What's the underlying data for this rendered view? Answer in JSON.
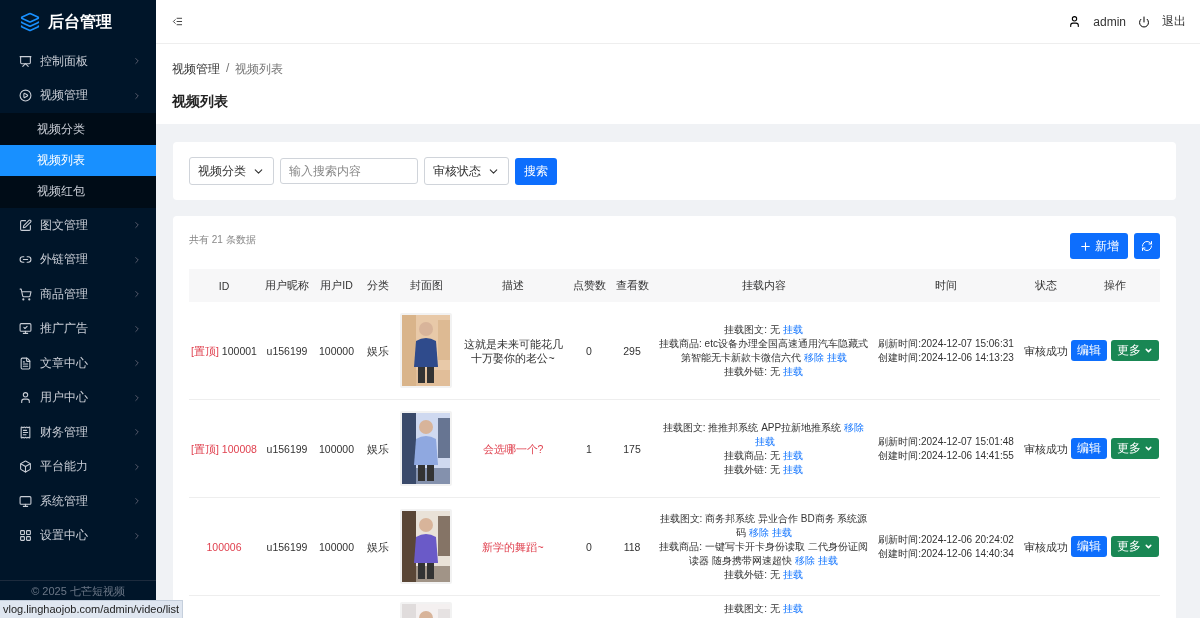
{
  "sidebar": {
    "logo": "后台管理",
    "items": [
      {
        "label": "控制面板",
        "selected": false
      },
      {
        "label": "视频管理",
        "expanded": true,
        "selected": false,
        "children": [
          {
            "label": "视频分类",
            "selected": false
          },
          {
            "label": "视频列表",
            "selected": true
          },
          {
            "label": "视频红包",
            "selected": false
          }
        ]
      },
      {
        "label": "图文管理",
        "selected": false
      },
      {
        "label": "外链管理",
        "selected": false
      },
      {
        "label": "商品管理",
        "selected": false
      },
      {
        "label": "推广广告",
        "selected": false
      },
      {
        "label": "文章中心",
        "selected": false
      },
      {
        "label": "用户中心",
        "selected": false
      },
      {
        "label": "财务管理",
        "selected": false
      },
      {
        "label": "平台能力",
        "selected": false
      },
      {
        "label": "系统管理",
        "selected": false
      },
      {
        "label": "设置中心",
        "selected": false
      }
    ],
    "footer": "© 2025 七芒短视频"
  },
  "header": {
    "user": "admin",
    "logout": "退出"
  },
  "breadcrumb": {
    "items": [
      "视频管理",
      "视频列表"
    ],
    "separator": "/"
  },
  "page_title": "视频列表",
  "filters": {
    "category_select": "视频分类",
    "search": {
      "placeholder": "输入搜索内容"
    },
    "status_select": "审核状态",
    "search_button": "搜索"
  },
  "table": {
    "summary": "共有 21 条数据",
    "add_button": "新增",
    "columns": [
      "ID",
      "用户昵称",
      "用户ID",
      "分类",
      "封面图",
      "描述",
      "点赞数",
      "查看数",
      "挂载内容",
      "时间",
      "状态",
      "操作"
    ],
    "rows": [
      {
        "pinned_tag": "[置顶]",
        "id": "100001",
        "highlight": false,
        "nickname": "u156199",
        "user_id": "100000",
        "category": "娱乐",
        "cover": {
          "kind": "picture"
        },
        "description": "这就是未来可能花几十万娶你的老公~",
        "likes": "0",
        "views": "295",
        "mounts": [
          {
            "text": "挂载图文: 无",
            "links": [
              "挂载"
            ]
          },
          {
            "text": "挂载商品: etc设备办理全国高速通用汽车隐藏式第智能无卡新款卡微信六代",
            "links": [
              "移除",
              "挂载"
            ]
          },
          {
            "text": "挂载外链: 无",
            "links": [
              "挂载"
            ]
          }
        ],
        "refresh_time": "刷新时间:2024-12-07 15:06:31",
        "create_time": "创建时间:2024-12-06 14:13:23",
        "status": "审核成功",
        "actions": [
          "编辑",
          "更多"
        ]
      },
      {
        "pinned_tag": "[置顶]",
        "id": "100008",
        "highlight": true,
        "nickname": "u156199",
        "user_id": "100000",
        "category": "娱乐",
        "cover": {
          "kind": "picture"
        },
        "description": "会选哪一个?",
        "likes": "1",
        "views": "175",
        "mounts": [
          {
            "text": "挂载图文: 推推邦系统 APP拉新地推系统",
            "links": [
              "移除",
              "挂载"
            ]
          },
          {
            "text": "挂载商品: 无",
            "links": [
              "挂载"
            ]
          },
          {
            "text": "挂载外链: 无",
            "links": [
              "挂载"
            ]
          }
        ],
        "refresh_time": "刷新时间:2024-12-07 15:01:48",
        "create_time": "创建时间:2024-12-06 14:41:55",
        "status": "审核成功",
        "actions": [
          "编辑",
          "更多"
        ]
      },
      {
        "id": "100006",
        "highlight": true,
        "nickname": "u156199",
        "user_id": "100000",
        "category": "娱乐",
        "cover": {
          "kind": "picture"
        },
        "description": "新学的舞蹈~",
        "likes": "0",
        "views": "118",
        "mounts": [
          {
            "text": "挂载图文: 商务邦系统 异业合作 BD商务 系统源码",
            "links": [
              "移除",
              "挂载"
            ]
          },
          {
            "text": "挂载商品: 一键写卡开卡身份读取 二代身份证阅读器 随身携带网速超快",
            "links": [
              "移除",
              "挂载"
            ]
          },
          {
            "text": "挂载外链: 无",
            "links": [
              "挂载"
            ]
          }
        ],
        "refresh_time": "刷新时间:2024-12-06 20:24:02",
        "create_time": "创建时间:2024-12-06 14:40:34",
        "status": "审核成功",
        "actions": [
          "编辑",
          "更多"
        ]
      },
      {
        "cover": {
          "kind": "picture"
        },
        "mounts": [
          {
            "text": "挂载图文: 无",
            "links": [
              "挂载"
            ]
          }
        ]
      }
    ]
  },
  "status_bar": "vlog.linghaojob.com/admin/video/list"
}
